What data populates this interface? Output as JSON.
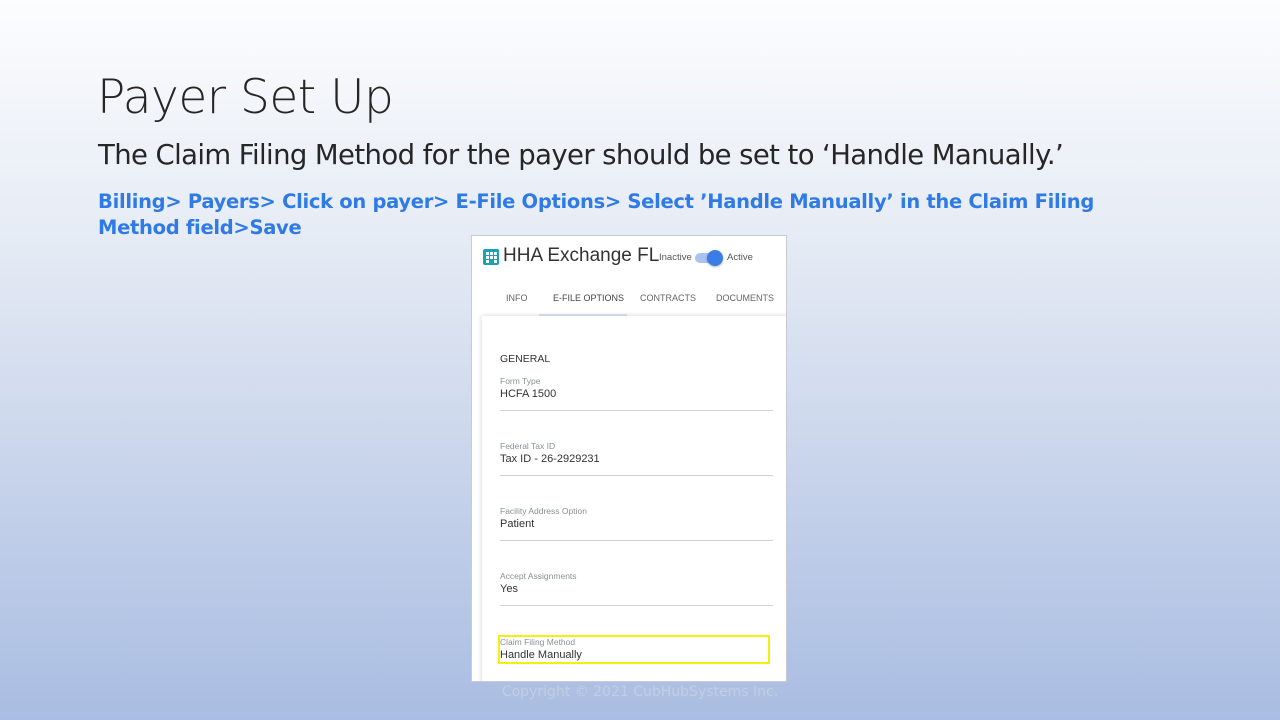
{
  "slide": {
    "title": "Payer Set Up",
    "subtitle": "The Claim Filing Method for the payer should be set to ‘Handle Manually.’",
    "path": "Billing> Payers> Click on payer> E-File Options> Select ’Handle Manually’ in the Claim Filing Method field>Save",
    "footer": "Copyright © 2021 CubHubSystems Inc."
  },
  "app": {
    "title": "HHA Exchange FL",
    "status": {
      "inactive_label": "Inactive",
      "active_label": "Active",
      "is_active": true
    },
    "tabs": [
      {
        "label": "INFO"
      },
      {
        "label": "E-FILE OPTIONS",
        "active": true
      },
      {
        "label": "CONTRACTS"
      },
      {
        "label": "DOCUMENTS"
      }
    ],
    "section_label": "GENERAL",
    "fields": [
      {
        "label": "Form Type",
        "value": "HCFA 1500"
      },
      {
        "label": "Federal Tax ID",
        "value": "Tax ID - 26-2929231"
      },
      {
        "label": "Facility Address Option",
        "value": "Patient"
      },
      {
        "label": "Accept Assignments",
        "value": "Yes"
      },
      {
        "label": "Claim Filing Method",
        "value": "Handle Manually"
      }
    ],
    "logo_icon": "building-icon",
    "colors": {
      "accent": "#3b7de6",
      "logo": "#16a3b8",
      "highlight": "#f2f00e",
      "path_text": "#2f7ae5"
    }
  }
}
